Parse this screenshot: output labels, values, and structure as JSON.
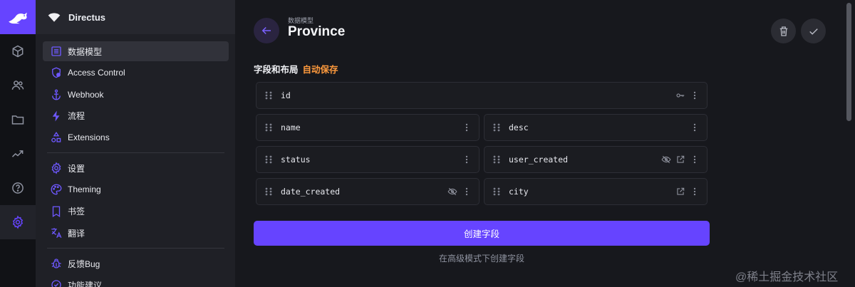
{
  "project_name": "Directus",
  "modules": [
    {
      "name": "content"
    },
    {
      "name": "users"
    },
    {
      "name": "files"
    },
    {
      "name": "insights"
    },
    {
      "name": "help"
    },
    {
      "name": "settings"
    }
  ],
  "nav": {
    "group1": [
      "数据模型",
      "Access Control",
      "Webhook",
      "流程",
      "Extensions"
    ],
    "group2": [
      "设置",
      "Theming",
      "书签",
      "翻译"
    ],
    "group3": [
      "反馈Bug",
      "功能建议"
    ]
  },
  "header": {
    "breadcrumb": "数据模型",
    "title": "Province"
  },
  "section": {
    "label": "字段和布局",
    "autosave": "自动保存"
  },
  "fields": {
    "id": "id",
    "name": "name",
    "desc": "desc",
    "status": "status",
    "user_created": "user_created",
    "date_created": "date_created",
    "city": "city"
  },
  "create_button": "创建字段",
  "advanced_link": "在高级模式下创建字段",
  "watermark": "@稀土掘金技术社区",
  "colors": {
    "accent": "#6644ff",
    "autosave": "#ff9a3d",
    "background": "#17181d"
  }
}
